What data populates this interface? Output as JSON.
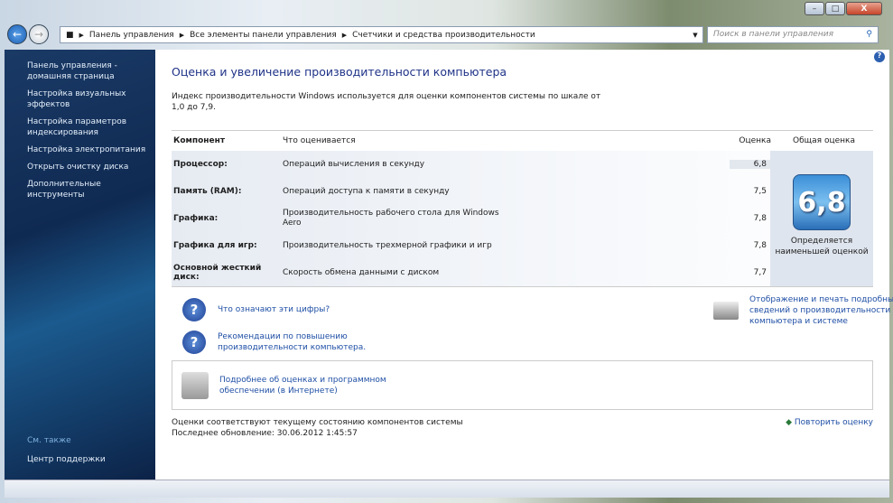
{
  "window": {
    "minimize": "–",
    "maximize": "□",
    "close": "X"
  },
  "address": {
    "crumbs": [
      "Панель управления",
      "Все элементы панели управления",
      "Счетчики и средства производительности"
    ]
  },
  "search": {
    "placeholder": "Поиск в панели управления"
  },
  "sidebar": {
    "items": [
      "Панель управления - домашняя страница",
      "Настройка визуальных эффектов",
      "Настройка параметров индексирования",
      "Настройка электропитания",
      "Открыть очистку диска",
      "Дополнительные инструменты"
    ],
    "see_also": "См. также",
    "support": "Центр поддержки"
  },
  "main": {
    "title": "Оценка и увеличение производительности компьютера",
    "intro": "Индекс производительности Windows используется для оценки компонентов системы по шкале от 1,0 до 7,9.",
    "headers": {
      "component": "Компонент",
      "what": "Что оценивается",
      "score": "Оценка",
      "overall": "Общая оценка"
    },
    "rows": [
      {
        "component": "Процессор:",
        "what": "Операций вычисления в секунду",
        "score": "6,8"
      },
      {
        "component": "Память (RAM):",
        "what": "Операций доступа к памяти в секунду",
        "score": "7,5"
      },
      {
        "component": "Графика:",
        "what": "Производительность рабочего стола для Windows Aero",
        "score": "7,8"
      },
      {
        "component": "Графика для игр:",
        "what": "Производительность трехмерной графики и игр",
        "score": "7,8"
      },
      {
        "component": "Основной жесткий диск:",
        "what": "Скорость обмена данными с диском",
        "score": "7,7"
      }
    ],
    "overall_score": "6,8",
    "overall_note": "Определяется наименьшей оценкой",
    "link_numbers": "Что означают эти цифры?",
    "link_tips": "Рекомендации по повышению производительности компьютера.",
    "link_print": "Отображение и печать подробных сведений о производительности компьютера и системе",
    "link_more": "Подробнее об оценках и программном обеспечении (в Интернете)",
    "status_line": "Оценки соответствуют текущему состоянию компонентов системы",
    "last_update": "Последнее обновление: 30.06.2012 1:45:57",
    "rerun": "Повторить оценку"
  }
}
